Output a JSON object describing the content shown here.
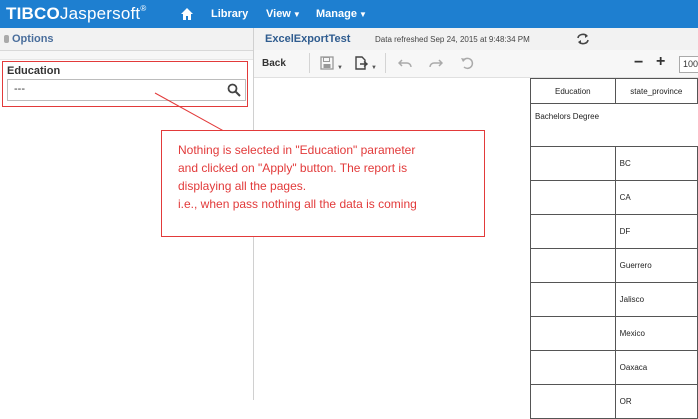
{
  "header": {
    "logo_brand": "TIBCO",
    "logo_product": "Jaspersoft",
    "logo_tm": "®",
    "nav": [
      {
        "label": "Library",
        "dropdown": false
      },
      {
        "label": "View",
        "dropdown": true
      },
      {
        "label": "Manage",
        "dropdown": true
      }
    ],
    "bar_color": "#1e7fd0"
  },
  "options_panel": {
    "title": "Options",
    "fields": [
      {
        "label": "Education",
        "value": "---"
      }
    ]
  },
  "report": {
    "title": "ExcelExportTest",
    "refreshed": "Data refreshed Sep 24, 2015 at 9:48:34 PM",
    "toolbar": {
      "back_label": "Back",
      "zoom_value": "100"
    },
    "table": {
      "columns": [
        "Education",
        "state_province"
      ],
      "group": "Bachelors Degree",
      "rows": [
        "BC",
        "CA",
        "DF",
        "Guerrero",
        "Jalisco",
        "Mexico",
        "Oaxaca",
        "OR"
      ]
    }
  },
  "annotation": {
    "lines": [
      "Nothing is selected in \"Education\" parameter",
      "and clicked on \"Apply\" button. The report is",
      "displaying all the pages.",
      "i.e., when pass nothing all the data is coming"
    ],
    "color": "#e23a3a"
  }
}
